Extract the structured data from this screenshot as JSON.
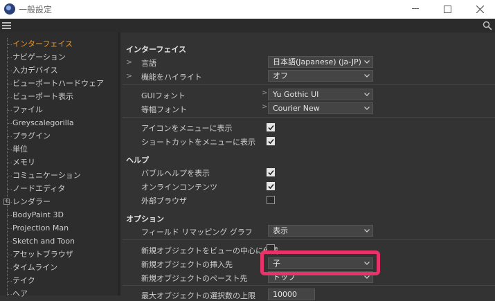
{
  "window": {
    "title": "一般設定"
  },
  "sidebar": {
    "items": [
      {
        "label": "インターフェイス",
        "active": true
      },
      {
        "label": "ナビゲーション"
      },
      {
        "label": "入力デバイス"
      },
      {
        "label": "ビューポートハードウェア"
      },
      {
        "label": "ビューポート表示"
      },
      {
        "label": "ファイル"
      },
      {
        "label": "Greyscalegorilla"
      },
      {
        "label": "プラグイン"
      },
      {
        "label": "単位"
      },
      {
        "label": "メモリ"
      },
      {
        "label": "コミュニケーション"
      },
      {
        "label": "ノードエディタ"
      },
      {
        "label": "レンダラー",
        "expandable": true
      },
      {
        "label": "BodyPaint 3D"
      },
      {
        "label": "Projection Man"
      },
      {
        "label": "Sketch and Toon"
      },
      {
        "label": "アセットブラウザ"
      },
      {
        "label": "タイムライン"
      },
      {
        "label": "テイク"
      },
      {
        "label": "ヘア"
      }
    ]
  },
  "main": {
    "interface": {
      "title": "インターフェイス",
      "language_label": "言語",
      "language_value": "日本語(Japanese) (ja-JP)",
      "highlight_label": "機能をハイライト",
      "highlight_value": "オフ",
      "gui_font_label": "GUIフォント",
      "gui_font_value": "Yu Gothic UI",
      "mono_font_label": "等幅フォント",
      "mono_font_value": "Courier New",
      "show_icons_label": "アイコンをメニューに表示",
      "show_icons": true,
      "show_shortcuts_label": "ショートカットをメニューに表示",
      "show_shortcuts": true
    },
    "help": {
      "title": "ヘルプ",
      "bubble_help_label": "バブルヘルプを表示",
      "bubble_help": true,
      "online_content_label": "オンラインコンテンツ",
      "online_content": true,
      "external_browser_label": "外部ブラウザ",
      "external_browser": false
    },
    "options": {
      "title": "オプション",
      "field_remap_label": "フィールド リマッピング グラフ",
      "field_remap_value": "表示",
      "new_obj_center_label": "新規オブジェクトをビューの中心に作成",
      "new_obj_insert_label": "新規オブジェクトの挿入先",
      "new_obj_insert_value": "子",
      "new_obj_paste_label": "新規オブジェクトのペースト先",
      "new_obj_paste_value": "トップ",
      "max_label": "最大オブジェクトの選択数の上限",
      "max_value": "10000"
    }
  },
  "colors": {
    "accent": "#ee9a2e",
    "highlight_border": "#e8336a",
    "panel_bg": "#333333"
  }
}
